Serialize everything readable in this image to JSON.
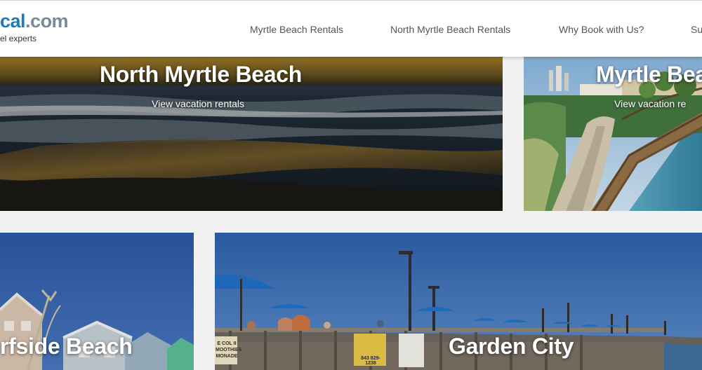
{
  "logo": {
    "name_part_a": "cal",
    "name_part_b": ".com",
    "tagline": "el experts"
  },
  "nav": {
    "items": [
      {
        "label": "Myrtle Beach Rentals"
      },
      {
        "label": "North Myrtle Beach Rentals"
      },
      {
        "label": "Why Book with Us?"
      },
      {
        "label": "Su"
      }
    ]
  },
  "tiles": [
    {
      "title": "North Myrtle Beach",
      "link": "View vacation rentals"
    },
    {
      "title": "Myrtle Bea",
      "link": "View vacation re"
    },
    {
      "title": "rfside Beach"
    },
    {
      "title": "Garden City"
    }
  ],
  "signs": {
    "sign_left_line1": "E COL II",
    "sign_left_line2": "MOOTHIES",
    "sign_left_line3": "MONADE",
    "sign_phone": "843 829-1238"
  },
  "colors": {
    "accent": "#1f7ab8",
    "logo_gray": "#7c8a93",
    "page_background": "#f1f1f1",
    "nav_text": "#555555"
  }
}
